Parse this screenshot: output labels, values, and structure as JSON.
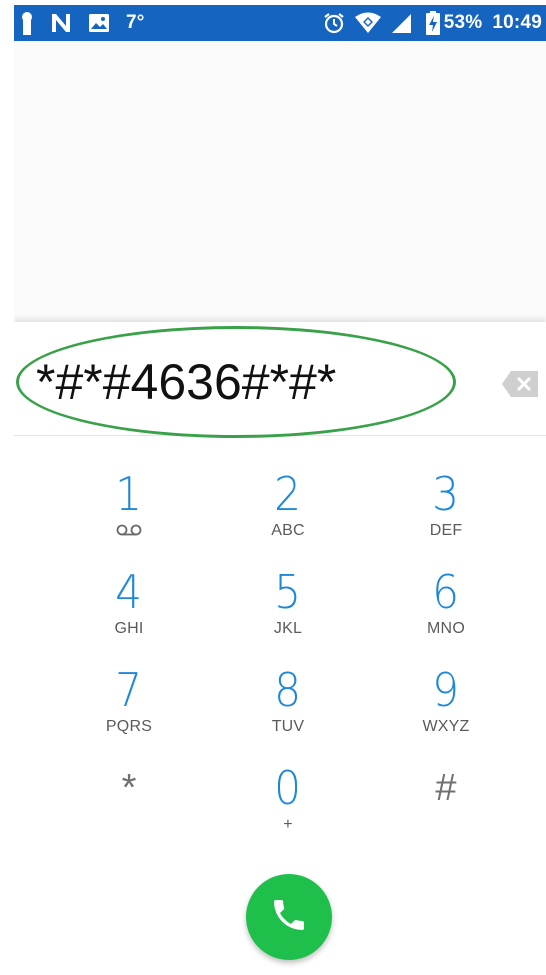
{
  "status_bar": {
    "temperature": "7°",
    "battery_percent": "53%",
    "time": "10:49",
    "icons_left": [
      "keyhole-icon",
      "n-notification-icon",
      "image-icon"
    ],
    "icons_right": [
      "alarm-icon",
      "wifi-icon",
      "signal-icon",
      "battery-icon"
    ]
  },
  "dialer": {
    "number": "*#*#4636#*#*",
    "backspace_icon": "backspace-icon",
    "keys": [
      {
        "digit": "1",
        "letters": "",
        "voicemail": true
      },
      {
        "digit": "2",
        "letters": "ABC"
      },
      {
        "digit": "3",
        "letters": "DEF"
      },
      {
        "digit": "4",
        "letters": "GHI"
      },
      {
        "digit": "5",
        "letters": "JKL"
      },
      {
        "digit": "6",
        "letters": "MNO"
      },
      {
        "digit": "7",
        "letters": "PQRS"
      },
      {
        "digit": "8",
        "letters": "TUV"
      },
      {
        "digit": "9",
        "letters": "WXYZ"
      },
      {
        "digit": "*",
        "letters": ""
      },
      {
        "digit": "0",
        "letters": "+"
      },
      {
        "digit": "#",
        "letters": ""
      }
    ],
    "call_icon": "phone-icon"
  },
  "colors": {
    "status_bar": "#1565c0",
    "digit_blue": "#1e88d8",
    "call_green": "#1fbf4c",
    "highlight_ring": "#3aa14a"
  }
}
